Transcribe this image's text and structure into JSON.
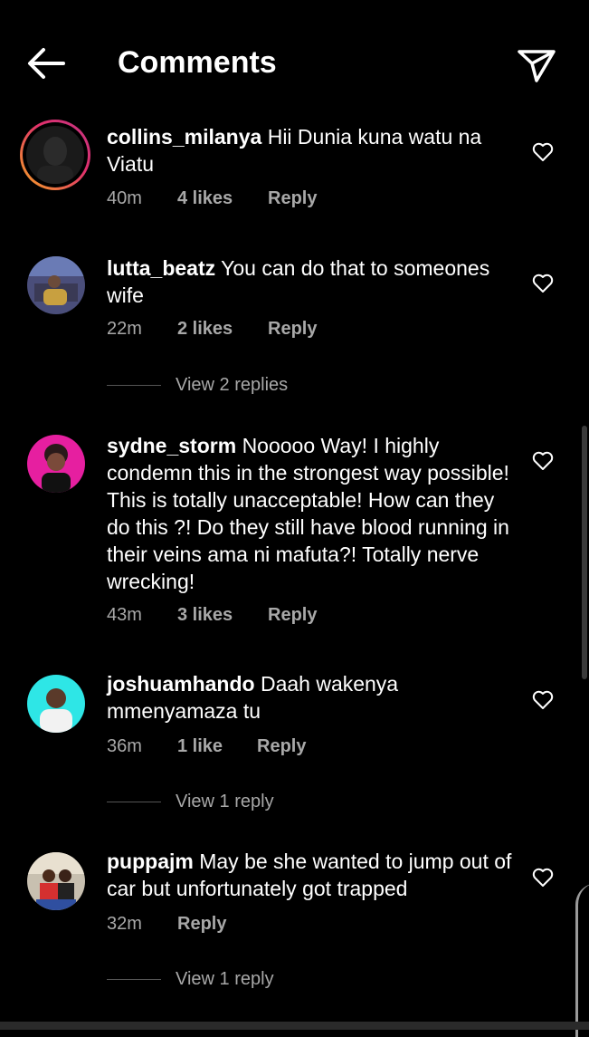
{
  "header": {
    "title": "Comments"
  },
  "comments": [
    {
      "username": "collins_milanya",
      "text": "Hii Dunia kuna watu na Viatu",
      "time": "40m",
      "likes": "4 likes",
      "reply": "Reply"
    },
    {
      "username": "lutta_beatz",
      "text": "You can do that to someones wife",
      "time": "22m",
      "likes": "2 likes",
      "reply": "Reply",
      "view_replies": "View 2 replies"
    },
    {
      "username": "sydne_storm",
      "text": "Nooooo Way! I highly condemn this in the strongest  way possible! This is totally unacceptable! How can they do this ?! Do they still have blood running in their veins ama ni mafuta?! Totally nerve wrecking!",
      "time": "43m",
      "likes": "3 likes",
      "reply": "Reply"
    },
    {
      "username": "joshuamhando",
      "text": "Daah wakenya mmenyamaza tu",
      "time": "36m",
      "likes": "1 like",
      "reply": "Reply",
      "view_replies": "View 1 reply"
    },
    {
      "username": "puppajm",
      "text": "May be she wanted to jump out of car  but unfortunately got trapped",
      "time": "32m",
      "likes": "",
      "reply": "Reply",
      "view_replies": "View 1 reply"
    }
  ],
  "icons": {
    "back": "arrow-left-icon",
    "send": "paper-plane-icon",
    "like": "heart-icon"
  }
}
